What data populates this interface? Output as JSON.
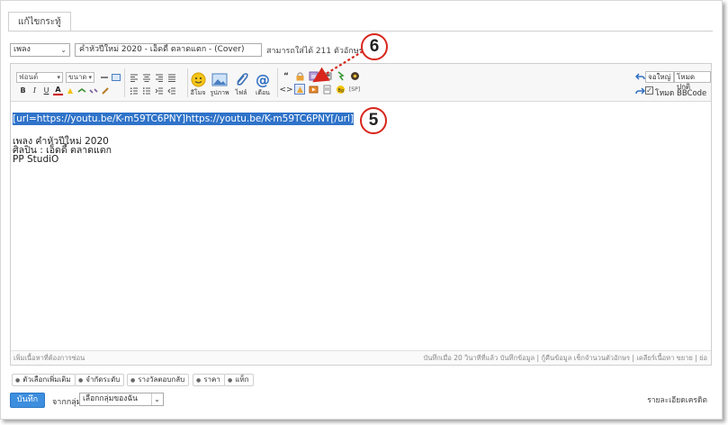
{
  "tab": {
    "label": "แก้ไขกระทู้"
  },
  "prefix": {
    "value": "เพลง"
  },
  "title_input": {
    "value": "คำหัวปีใหม่ 2020 - เอ็ดดี้ ตลาดแตก - (Cover)"
  },
  "remaining": {
    "text": "สามารถใส่ได้ 211 ตัวอักษร"
  },
  "toolbar": {
    "font_select": "ฟอนต์",
    "size_select": "ขนาด",
    "emoji_label": "อีโมจ",
    "image_label": "รูปภาพ",
    "file_label": "ไฟล์",
    "mention_label": "เตือน",
    "quote_symbol": "“",
    "code_symbol": "<>",
    "spoiler_label": "[SP]",
    "bold": "B",
    "italic": "I",
    "underline": "U",
    "text_color": "A",
    "fullscreen_button": "จอใหญ่",
    "normal_mode_button": "โหมดปกติ",
    "bbcode_label": "โหมด BBCode",
    "bbcode_checked": true
  },
  "content": {
    "selected_line": "[url=https://youtu.be/K-m59TC6PNY]https://youtu.be/K-m59TC6PNY[/url]",
    "line1": "เพลง   คำหัวปีใหม่ 2020",
    "line2": "ศิลปิน : เอ็ดดี้ ตลาดแตก",
    "line3": "PP StudiO"
  },
  "status_bar": {
    "left": "เพิ่มเนื้อหาที่ต้องการซ่อน",
    "right": "บันทึกเมื่อ 20 วินาทีที่แล้ว บันทึกข้อมูล | กู้คืนข้อมูล    เช็กจำนวนตัวอักษร | เคลียร์เนื้อหา          ขยาย | ย่อ"
  },
  "option_chips": [
    "ตัวเลือกเพิ่มเติม",
    "จำกัดระดับ",
    "รางวัลตอบกลับ",
    "ราคา",
    "แท็ก"
  ],
  "submit_button": "บันทึก",
  "group": {
    "label": "จากกลุ่ม:",
    "value": "เลือกกลุ่มของฉัน"
  },
  "credits_link": "รายละเอียดเครดิต",
  "annotations": {
    "callout_5": "5",
    "callout_6": "6"
  },
  "colors": {
    "accent": "#3d8ede",
    "selection": "#2f73c9",
    "callout": "#d8261c"
  }
}
